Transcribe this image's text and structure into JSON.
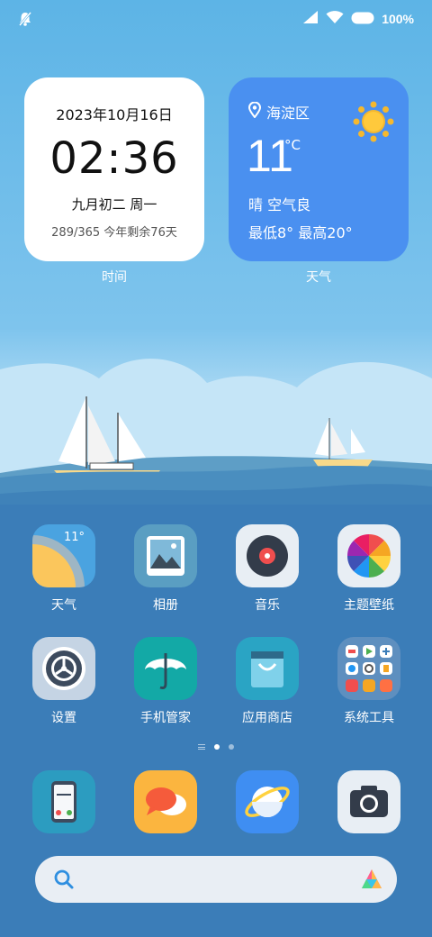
{
  "status_bar": {
    "mute_icon": "bell-off-icon",
    "signal_icon": "signal-icon",
    "wifi_icon": "wifi-icon",
    "battery_icon": "battery-icon",
    "battery_text": "100%"
  },
  "clock_widget": {
    "date": "2023年10月16日",
    "time": "02:36",
    "lunar": "九月初二 周一",
    "year_progress": "289/365 今年剩余76天",
    "label": "时间"
  },
  "weather_widget": {
    "location": "海淀区",
    "temperature": "11",
    "unit": "°C",
    "condition": "晴 空气良",
    "range": "最低8°  最高20°",
    "label": "天气",
    "accent": "#4a90f0"
  },
  "apps_row1": [
    {
      "label": "天气",
      "icon": "weather-app-icon",
      "mini_temp": "11°"
    },
    {
      "label": "相册",
      "icon": "gallery-icon"
    },
    {
      "label": "音乐",
      "icon": "music-icon"
    },
    {
      "label": "主题壁纸",
      "icon": "themes-icon"
    }
  ],
  "apps_row2": [
    {
      "label": "设置",
      "icon": "settings-icon"
    },
    {
      "label": "手机管家",
      "icon": "security-icon"
    },
    {
      "label": "应用商店",
      "icon": "app-store-icon"
    },
    {
      "label": "系统工具",
      "icon": "tools-folder-icon"
    }
  ],
  "dock": [
    {
      "icon": "phone-icon"
    },
    {
      "icon": "messages-icon"
    },
    {
      "icon": "browser-icon"
    },
    {
      "icon": "camera-icon"
    }
  ],
  "search": {
    "search_icon": "search-icon",
    "assistant_icon": "assistant-icon"
  }
}
